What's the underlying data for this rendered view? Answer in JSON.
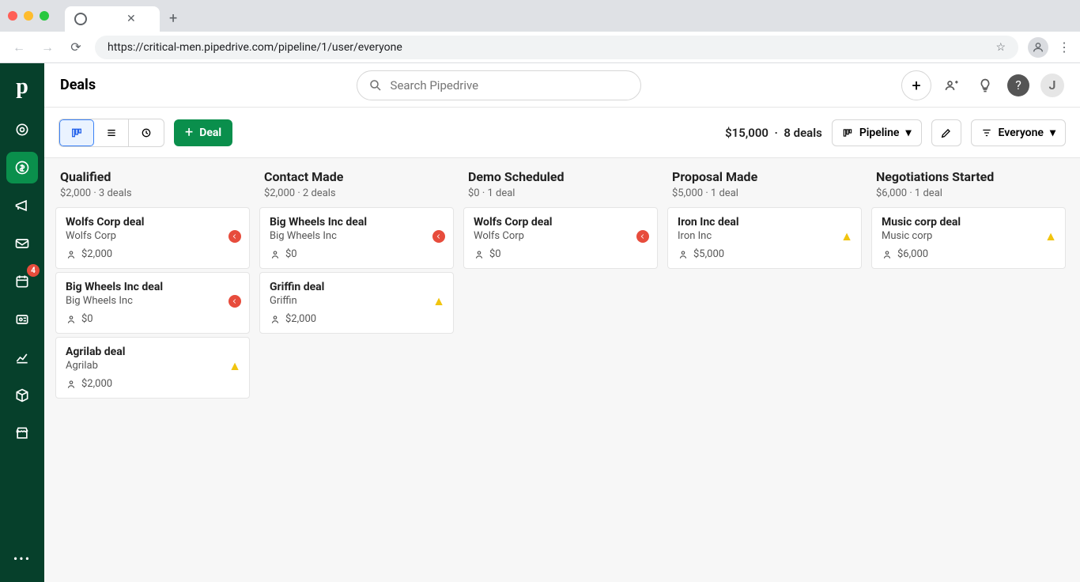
{
  "browser": {
    "url": "https://critical-men.pipedrive.com/pipeline/1/user/everyone"
  },
  "header": {
    "title": "Deals",
    "search_placeholder": "Search Pipedrive",
    "avatar_initial": "J"
  },
  "toolbar": {
    "deal_label": "Deal",
    "summary_amount": "$15,000",
    "summary_deals": "8 deals",
    "pipeline_label": "Pipeline",
    "filter_label": "Everyone"
  },
  "sidebar": {
    "badge": "4"
  },
  "columns": [
    {
      "title": "Qualified",
      "amount": "$2,000",
      "count": "3 deals",
      "cards": [
        {
          "title": "Wolfs Corp deal",
          "org": "Wolfs Corp",
          "value": "$2,000",
          "status": "red"
        },
        {
          "title": "Big Wheels Inc deal",
          "org": "Big Wheels Inc",
          "value": "$0",
          "status": "red"
        },
        {
          "title": "Agrilab deal",
          "org": "Agrilab",
          "value": "$2,000",
          "status": "warn"
        }
      ]
    },
    {
      "title": "Contact Made",
      "amount": "$2,000",
      "count": "2 deals",
      "cards": [
        {
          "title": "Big Wheels Inc deal",
          "org": "Big Wheels Inc",
          "value": "$0",
          "status": "red"
        },
        {
          "title": "Griffin deal",
          "org": "Griffin",
          "value": "$2,000",
          "status": "warn"
        }
      ]
    },
    {
      "title": "Demo Scheduled",
      "amount": "$0",
      "count": "1 deal",
      "cards": [
        {
          "title": "Wolfs Corp deal",
          "org": "Wolfs Corp",
          "value": "$0",
          "status": "red"
        }
      ]
    },
    {
      "title": "Proposal Made",
      "amount": "$5,000",
      "count": "1 deal",
      "cards": [
        {
          "title": "Iron Inc deal",
          "org": "Iron Inc",
          "value": "$5,000",
          "status": "warn"
        }
      ]
    },
    {
      "title": "Negotiations Started",
      "amount": "$6,000",
      "count": "1 deal",
      "cards": [
        {
          "title": "Music corp deal",
          "org": "Music corp",
          "value": "$6,000",
          "status": "warn"
        }
      ]
    }
  ]
}
